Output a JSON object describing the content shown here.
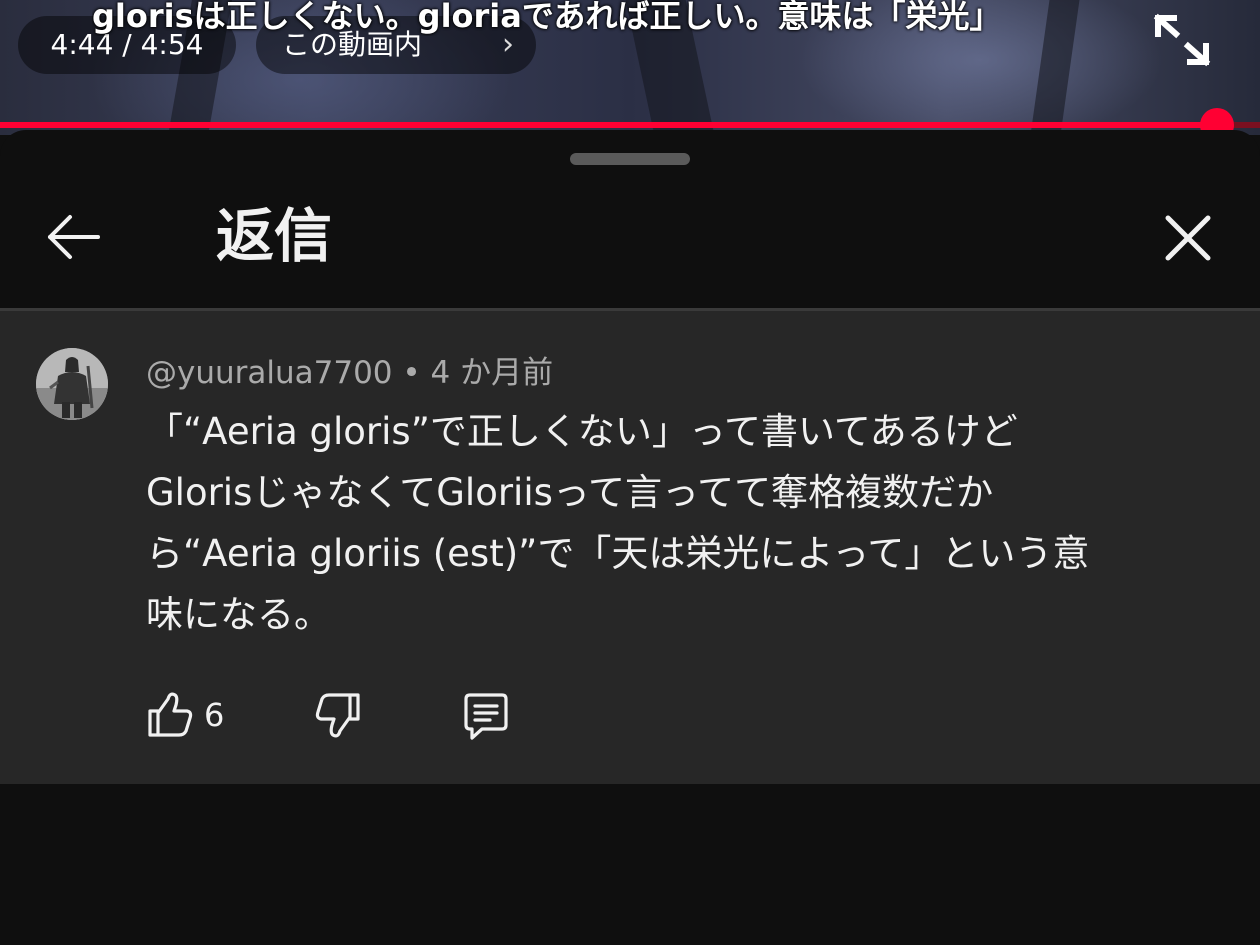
{
  "video": {
    "subtitle": "glorisは正しくない。gloriaであれば正しい。意味は「栄光」",
    "time": "4:44 / 4:54",
    "chapter": "この動画内",
    "progress_fraction": 0.966,
    "progress_color": "#ff0033"
  },
  "sheet": {
    "title": "返信"
  },
  "comment": {
    "author": "@yuuralua7700",
    "separator": " • ",
    "age": "4 か月前",
    "text": "「“Aeria gloris”で正しくない」って書いてあるけど\nGlorisじゃなくてGloriisって言ってて奪格複数だか\nら“Aeria gloriis (est)”で「天は栄光によって」という意\n味になる。",
    "like_count": "6"
  },
  "icons": {
    "fullscreen": "fullscreen-exit-icon",
    "chevron": "chevron-right-icon",
    "back": "back-arrow-icon",
    "close": "close-icon",
    "like": "thumbs-up-icon",
    "dislike": "thumbs-down-icon",
    "reply": "reply-comment-icon"
  },
  "colors": {
    "background": "#0f0f0f",
    "card": "#272727",
    "accent": "#ff0033",
    "muted_text": "#aaaaaa"
  }
}
